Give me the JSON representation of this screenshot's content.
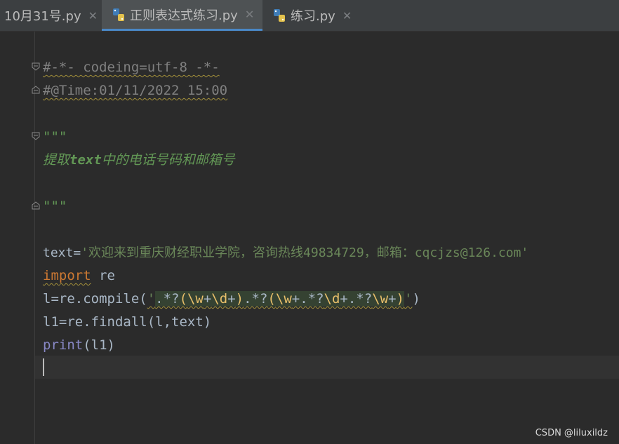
{
  "tabs": [
    {
      "label": "10月31号.py",
      "active": false
    },
    {
      "label": "正则表达式练习.py",
      "active": true
    },
    {
      "label": "练习.py",
      "active": false
    }
  ],
  "code": {
    "line1": "#-*- codeing=utf-8 -*-",
    "line2": "#@Time:01/11/2022 15:00",
    "line3": "\"\"\"",
    "doc_pre": "提取",
    "doc_bold": "text",
    "doc_post": "中的电话号码和邮箱号",
    "line5": "\"\"\"",
    "text_var": "text=",
    "text_str": "'欢迎来到重庆财经职业学院，咨询热线49834729，邮箱：cqcjzs@126.com'",
    "import_kw": "import",
    "import_mod": " re",
    "compile_pre": "l=re.compile(",
    "compile_q1": "'",
    "compile_q2": "'",
    "compile_post": ")",
    "findall": "l1=re.findall(l,text)",
    "print_kw": "print",
    "print_args": "(l1)"
  },
  "watermark": "CSDN @liluxildz",
  "colors": {
    "accent": "#4a88c7",
    "background": "#2b2b2b",
    "string": "#6a8759",
    "keyword": "#cc7832",
    "comment": "#808080"
  }
}
